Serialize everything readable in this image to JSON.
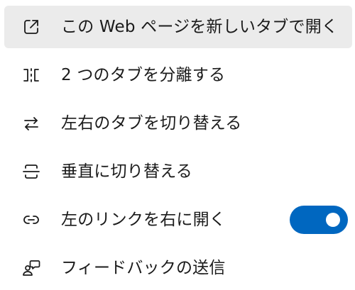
{
  "menu": {
    "items": [
      {
        "label": "この Web ページを新しいタブで開く",
        "icon": "open-in-new-tab-icon",
        "highlighted": true
      },
      {
        "label": "2 つのタブを分離する",
        "icon": "split-tabs-icon"
      },
      {
        "label": "左右のタブを切り替える",
        "icon": "swap-arrows-icon"
      },
      {
        "label": "垂直に切り替える",
        "icon": "split-vertical-icon"
      },
      {
        "label": "左のリンクを右に開く",
        "icon": "link-icon",
        "toggle": {
          "state": "on",
          "color": "#0067c0"
        }
      },
      {
        "label": "フィードバックの送信",
        "icon": "feedback-icon"
      }
    ]
  },
  "colors": {
    "highlight": "#ebebeb",
    "accent": "#0067c0",
    "text": "#1b1b1b"
  }
}
